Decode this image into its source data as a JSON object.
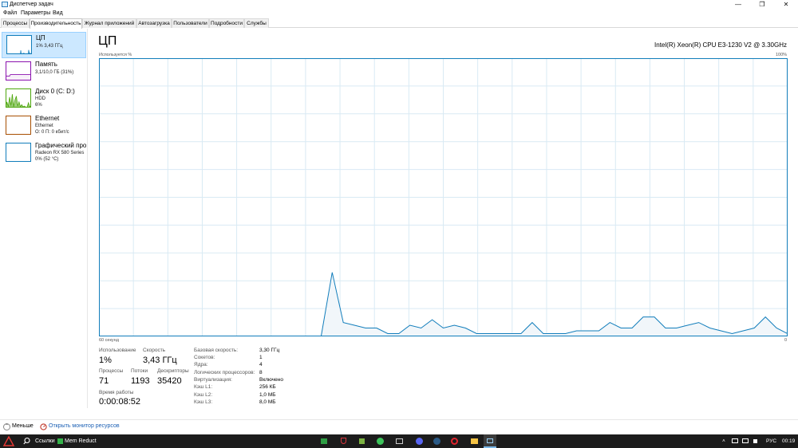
{
  "window": {
    "title": "Диспетчер задач",
    "minimize": "—",
    "restore": "❐",
    "close": "✕"
  },
  "menu": [
    "Файл",
    "Параметры",
    "Вид"
  ],
  "tabs": [
    {
      "label": "Процессы",
      "active": false
    },
    {
      "label": "Производительность",
      "active": true
    },
    {
      "label": "Журнал приложений",
      "active": false
    },
    {
      "label": "Автозагрузка",
      "active": false
    },
    {
      "label": "Пользователи",
      "active": false
    },
    {
      "label": "Подробности",
      "active": false
    },
    {
      "label": "Службы",
      "active": false
    }
  ],
  "sidebar": {
    "items": [
      {
        "title": "ЦП",
        "line1": "1% 3,43 ГГц",
        "line2": "",
        "line3": "",
        "color": "#117dbb",
        "fill": "#f1f6fa",
        "selected": true,
        "spark": [
          0,
          0,
          0,
          0,
          0,
          0,
          0,
          0,
          0,
          0,
          0,
          0,
          0,
          0,
          0,
          0,
          0,
          0,
          0,
          0,
          0,
          0,
          0,
          0,
          0,
          0,
          0,
          0,
          0,
          0,
          0,
          0,
          0,
          0,
          0,
          0,
          0,
          0,
          0,
          0,
          20,
          3,
          2,
          3,
          1,
          1,
          4,
          3,
          5,
          3,
          4,
          2,
          1,
          1,
          2,
          2,
          3,
          1,
          2,
          2,
          3,
          3,
          22,
          8,
          8,
          3,
          5,
          3,
          2,
          1,
          4,
          2
        ]
      },
      {
        "title": "Память",
        "line1": "3,1/10,0 ГБ (31%)",
        "line2": "",
        "line3": "",
        "color": "#8b12ae",
        "fill": "#f7f0f9",
        "selected": false,
        "level": 31
      },
      {
        "title": "Диск 0 (C: D:)",
        "line1": "HDD",
        "line2": "6%",
        "line3": "",
        "color": "#4da60c",
        "fill": "#eff7e9",
        "selected": false,
        "spark": [
          0,
          30,
          5,
          55,
          10,
          70,
          5,
          40,
          60,
          8,
          30,
          5,
          15,
          4,
          8,
          3,
          2,
          25,
          4,
          10
        ]
      },
      {
        "title": "Ethernet",
        "line1": "Ethernet",
        "line2": "О: 0 П: 0 кбит/с",
        "line3": "",
        "color": "#a74f01",
        "fill": "#fbf3ec",
        "selected": false
      },
      {
        "title": "Графический про",
        "line1": "Radeon RX 580 Series",
        "line2": "0% (52 °C)",
        "line3": "",
        "color": "#117dbb",
        "fill": "#f1f6fa",
        "selected": false
      }
    ]
  },
  "main": {
    "title": "ЦП",
    "cpu_model": "Intel(R) Xeon(R) CPU E3-1230 V2 @ 3.30GHz",
    "usage_label": "Используется %",
    "max_label": "100%",
    "time_label": "60 секунд",
    "zero_label": "0"
  },
  "chart_data": {
    "type": "area",
    "x": [
      0,
      1,
      2,
      3,
      4,
      5,
      6,
      7,
      8,
      9,
      10,
      11,
      12,
      13,
      14,
      15,
      16,
      17,
      18,
      19,
      20,
      21,
      22,
      23,
      24,
      25,
      26,
      27,
      28,
      29,
      30,
      31,
      32,
      33,
      34,
      35,
      36,
      37,
      38,
      39,
      40,
      41,
      42,
      43,
      44,
      45,
      46,
      47,
      48,
      49,
      50,
      51,
      52,
      53,
      54,
      55,
      56,
      57,
      58,
      59,
      60
    ],
    "y": [
      0,
      0,
      0,
      0,
      0,
      0,
      0,
      0,
      0,
      0,
      0,
      0,
      0,
      0,
      0,
      0,
      0,
      0,
      0,
      0,
      0,
      23,
      5,
      4,
      3,
      3,
      1,
      1,
      4,
      3,
      6,
      3,
      4,
      3,
      1,
      1,
      1,
      1,
      1,
      5,
      1,
      1,
      1,
      2,
      2,
      2,
      5,
      3,
      3,
      7,
      7,
      3,
      3,
      4,
      5,
      3,
      2,
      1,
      2,
      3,
      7,
      3,
      1
    ],
    "ylim": [
      0,
      100
    ],
    "xlim": [
      0,
      60
    ],
    "color": "#117dbb",
    "fill": "#f1f6fa",
    "grid": true
  },
  "stats": {
    "utilization": {
      "label": "Использование",
      "value": "1%"
    },
    "speed": {
      "label": "Скорость",
      "value": "3,43 ГГц"
    },
    "processes": {
      "label": "Процессы",
      "value": "71"
    },
    "threads": {
      "label": "Потоки",
      "value": "1193"
    },
    "handles": {
      "label": "Дескрипторы",
      "value": "35420"
    },
    "uptime": {
      "label": "Время работы",
      "value": "0:00:08:52"
    }
  },
  "specs": [
    {
      "label": "Базовая скорость:",
      "value": "3,30 ГГц"
    },
    {
      "label": "Сокетов:",
      "value": "1"
    },
    {
      "label": "Ядра:",
      "value": "4"
    },
    {
      "label": "Логических процессоров:",
      "value": "8"
    },
    {
      "label": "Виртуализация:",
      "value": "Включено"
    },
    {
      "label": "Кэш L1:",
      "value": "256 КБ"
    },
    {
      "label": "Кэш L2:",
      "value": "1,0 МБ"
    },
    {
      "label": "Кэш L3:",
      "value": "8,0 МБ"
    }
  ],
  "footer": {
    "fewer_label": "Меньше",
    "monitor_label": "Открыть монитор ресурсов"
  },
  "taskbar": {
    "links_label": "Ссылки",
    "memreduct_label": "Mem Reduct",
    "lang": "РУС",
    "time": "00:19"
  }
}
